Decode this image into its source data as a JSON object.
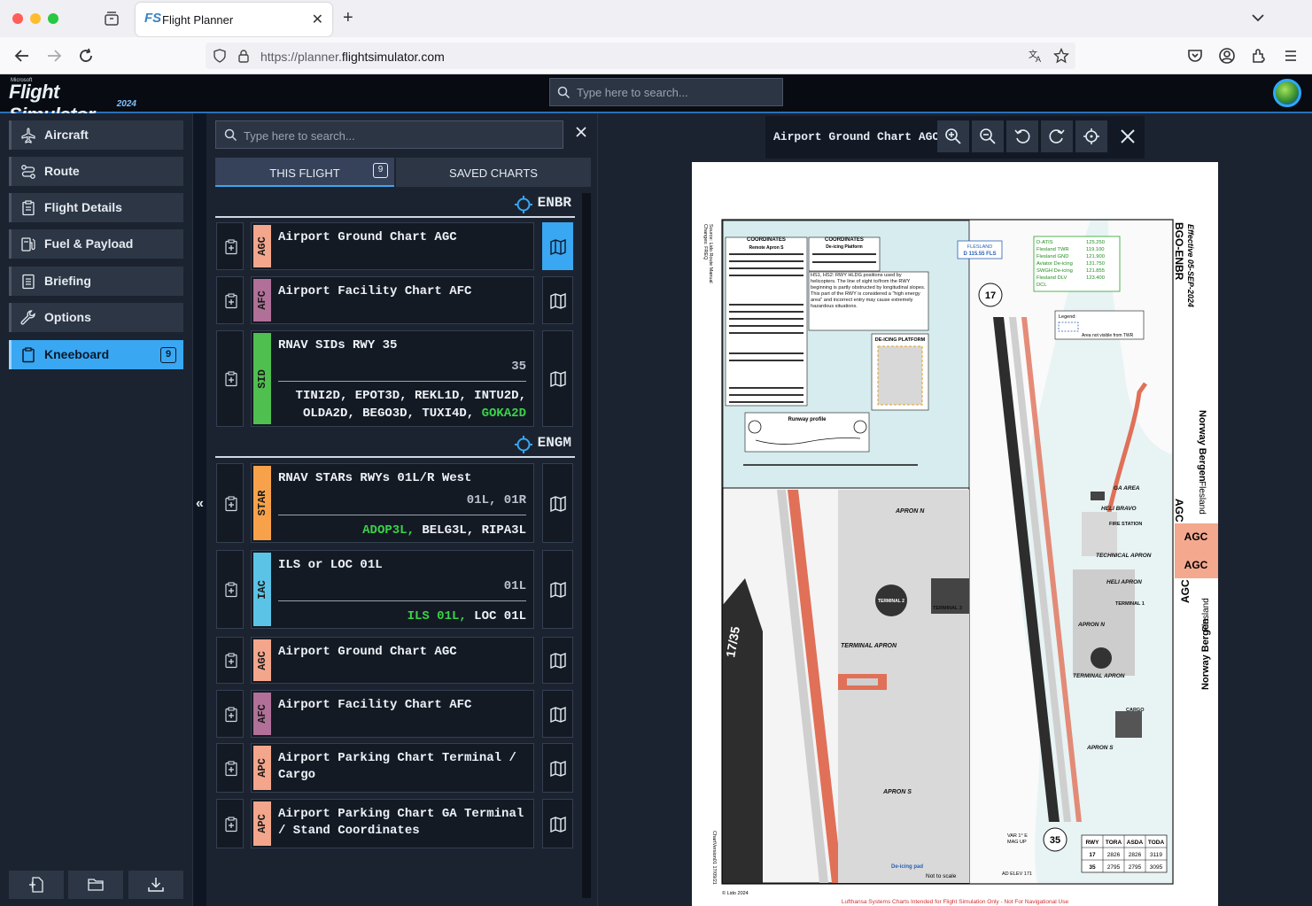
{
  "browser": {
    "tab_title": "Flight Planner",
    "tab_favicon": "FS",
    "url_prefix": "https://planner.",
    "url_domain": "flightsimulator.com"
  },
  "app": {
    "logo_small": "Microsoft",
    "logo_main": "Flight Simulator",
    "logo_year": "2024",
    "search_placeholder": "Type here to search..."
  },
  "sidebar": {
    "items": [
      {
        "label": "Aircraft",
        "icon": "airplane-icon"
      },
      {
        "label": "Route",
        "icon": "route-icon"
      },
      {
        "label": "Flight Details",
        "icon": "clipboard-icon"
      },
      {
        "label": "Fuel & Payload",
        "icon": "fuel-icon"
      },
      {
        "label": "Briefing",
        "icon": "document-icon"
      },
      {
        "label": "Options",
        "icon": "wrench-icon"
      },
      {
        "label": "Kneeboard",
        "icon": "kneeboard-icon",
        "badge": "9",
        "active": true
      }
    ],
    "collapse_label": "«"
  },
  "charts_panel": {
    "search_placeholder": "Type here to search...",
    "tab_this_flight": "THIS FLIGHT",
    "tab_this_flight_count": "9",
    "tab_saved_charts": "SAVED CHARTS",
    "airports": [
      {
        "code": "ENBR"
      },
      {
        "code": "ENGM"
      }
    ],
    "charts": [
      {
        "tag": "AGC",
        "color": "#f3a68c",
        "title": "Airport Ground Chart AGC",
        "active": true
      },
      {
        "tag": "AFC",
        "color": "#b07098",
        "title": "Airport Facility Chart AFC"
      },
      {
        "tag": "SID",
        "color": "#4fbf4f",
        "title": "RNAV SIDs RWY 35",
        "runways": "35",
        "procs_line1": "TINI2D, EPOT3D, REKL1D, INTU2D,",
        "procs_line2": "OLDA2D, BEGO3D, TUXI4D, ",
        "procs_line2_hl": "GOKA2D"
      },
      {
        "tag": "STAR",
        "color": "#f7a24a",
        "title": "RNAV STARs RWYs 01L/R West",
        "runways": "01L, 01R",
        "procs_hl": "ADOP3L,",
        "procs_rest": " BELG3L, RIPA3L"
      },
      {
        "tag": "IAC",
        "color": "#5bc4e6",
        "title": "ILS or LOC 01L",
        "runways": "01L",
        "procs_hl": "ILS 01L,",
        "procs_rest": " LOC 01L"
      },
      {
        "tag": "AGC",
        "color": "#f3a68c",
        "title": "Airport Ground Chart AGC"
      },
      {
        "tag": "AFC",
        "color": "#b07098",
        "title": "Airport Facility Chart AFC"
      },
      {
        "tag": "APC",
        "color": "#f3a68c",
        "title": "Airport Parking Chart Terminal / Cargo"
      },
      {
        "tag": "APC",
        "color": "#f3a68c",
        "title": "Airport Parking Chart GA Terminal / Stand Coordinates"
      }
    ]
  },
  "viewer": {
    "title": "Airport Ground Chart AGC",
    "page": {
      "effective": "Effective 05-SEP-2024",
      "icao": "BGO-ENBR",
      "city_country": "Norway Bergen",
      "airport": "Flesland",
      "chart_type": "AGC",
      "disclaimer": "Lufthansa Systems Charts Intended for Flight Simulation Only - Not For Navigational Use",
      "copyright": "© Lido 2024",
      "chart_version": "ChartVersion01 17/09/21",
      "changes": "Changes: FREQ",
      "source": "Source: Lido Route Manual",
      "not_to_scale": "Not to scale",
      "var": "VAR 1° E",
      "mag_up": "MAG UP",
      "ad_elev": "AD ELEV 171",
      "frequencies": [
        {
          "name": "D-ATIS",
          "freq": "125.250"
        },
        {
          "name": "Flesland TWR",
          "freq": "119.100"
        },
        {
          "name": "Flesland GND",
          "freq": "121.900"
        },
        {
          "name": "Aviator De-icing",
          "freq": "131.750"
        },
        {
          "name": "SWGH De-icing",
          "freq": "121.855"
        },
        {
          "name": "Flesland DLV",
          "freq": "123.400"
        },
        {
          "name": "DCL",
          "freq": ""
        }
      ],
      "vor": "FLESLAND",
      "vor_freq": "D 115.55 FLS",
      "runway_label": "17/35",
      "rwy_table": {
        "headers": [
          "RWY",
          "TORA",
          "ASDA",
          "TODA"
        ],
        "rows": [
          [
            "17",
            "2826",
            "2826",
            "3119"
          ],
          [
            "35",
            "2795",
            "2795",
            "3095"
          ]
        ]
      },
      "labels": {
        "apron_n": "APRON N",
        "apron_s": "APRON S",
        "terminal_apron": "TERMINAL APRON",
        "terminal_2": "TERMINAL 2",
        "terminal_3": "TERMINAL 3",
        "terminal_1": "TERMINAL 1",
        "deicing_platform": "DE-ICING PLATFORM",
        "deicing_pad": "De-icing pad",
        "ga_area": "GA AREA",
        "heli_bravo": "HELI BRAVO",
        "fire_station": "FIRE STATION",
        "technical_apron": "TECHNICAL APRON",
        "heli_apron": "HELI APRON",
        "cargo": "CARGO",
        "runway_profile": "Runway profile",
        "legend": "Legend:",
        "legend_item": "Area not visible from TWR",
        "hs_note": "HS1, HS2: RWY HLDG positions used by helicopters. The line of sight to/from the RWY beginning is partly obstructed by longitudinal slopes. This part of the RWY is considered a \"high energy area\" and incorrect entry may cause extremely hazardous situations.",
        "coords_title": "COORDINATES",
        "remote_apron": "Remote Apron S",
        "deicing_coords": "De-icing Platform"
      }
    }
  }
}
